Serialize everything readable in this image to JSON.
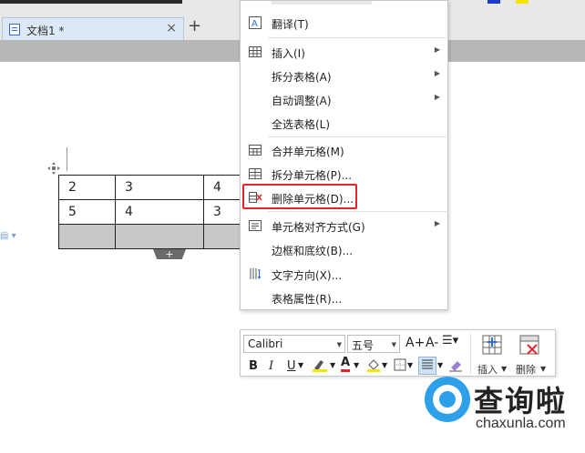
{
  "colors": {
    "highlight_border": "#e0262c",
    "accent_blue": "#2a6fcf",
    "selected_cell": "#c8c8c8"
  },
  "tab": {
    "title": "文档1 *",
    "close_glyph": "×",
    "new_tab_glyph": "+"
  },
  "table": {
    "rows": [
      [
        "2",
        "3",
        "4"
      ],
      [
        "5",
        "4",
        "3"
      ],
      [
        "",
        "",
        ""
      ]
    ],
    "add_row_glyph": "+"
  },
  "context_menu": {
    "items": [
      {
        "label": "翻译(T)",
        "icon": "translate-icon",
        "submenu": false
      },
      {
        "label": "插入(I)",
        "icon": "table-insert-icon",
        "submenu": true
      },
      {
        "label": "拆分表格(A)",
        "icon": "",
        "submenu": true
      },
      {
        "label": "自动调整(A)",
        "icon": "",
        "submenu": true
      },
      {
        "label": "全选表格(L)",
        "icon": "",
        "submenu": false
      },
      {
        "label": "合并单元格(M)",
        "icon": "merge-cells-icon",
        "submenu": false
      },
      {
        "label": "拆分单元格(P)...",
        "icon": "split-cells-icon",
        "submenu": false
      },
      {
        "label": "删除单元格(D)...",
        "icon": "delete-cells-icon",
        "submenu": false,
        "highlighted": true
      },
      {
        "label": "单元格对齐方式(G)",
        "icon": "cell-align-icon",
        "submenu": true
      },
      {
        "label": "边框和底纹(B)...",
        "icon": "",
        "submenu": false
      },
      {
        "label": "文字方向(X)...",
        "icon": "text-direction-icon",
        "submenu": false
      },
      {
        "label": "表格属性(R)...",
        "icon": "",
        "submenu": false
      }
    ]
  },
  "mini_toolbar": {
    "font_name": "Calibri",
    "font_size": "五号",
    "bold": "B",
    "italic": "I",
    "underline": "U",
    "font_color_glyph": "A",
    "grow_font": "A+",
    "shrink_font": "A-",
    "insert_label": "插入",
    "delete_label": "删除"
  },
  "watermark": {
    "title": "查询啦",
    "domain": "chaxunla.com"
  }
}
